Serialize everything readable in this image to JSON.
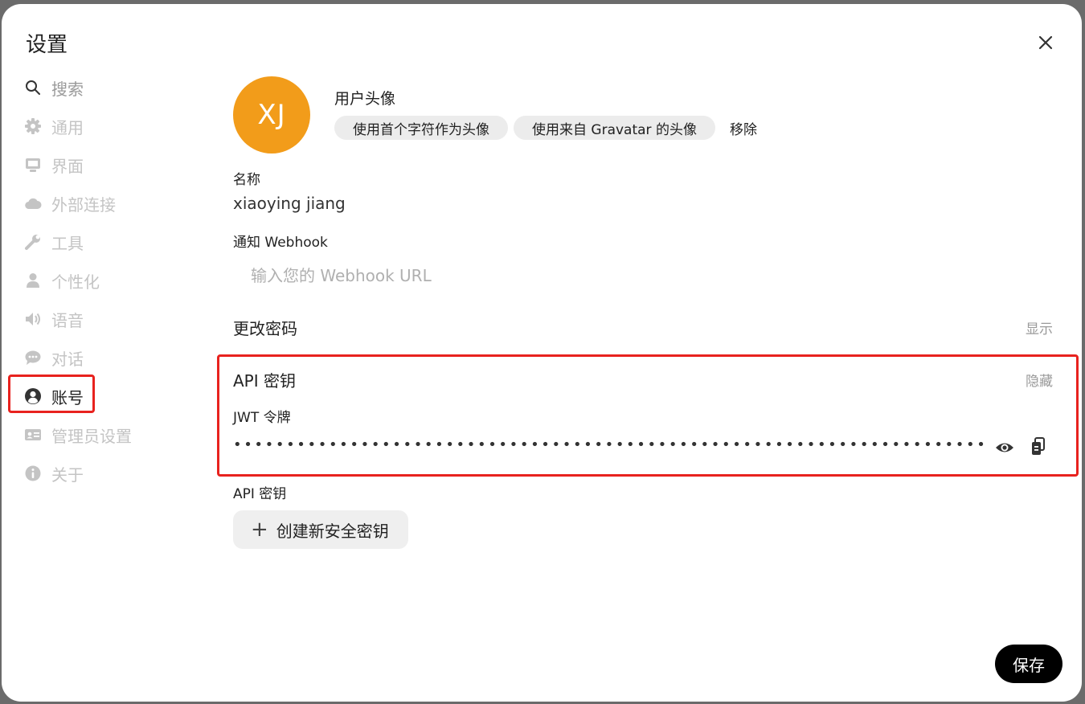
{
  "dialog": {
    "title": "设置",
    "close_icon": "close-icon"
  },
  "sidebar": {
    "items": [
      {
        "label": "搜索",
        "icon": "search-icon"
      },
      {
        "label": "通用",
        "icon": "gear-icon"
      },
      {
        "label": "界面",
        "icon": "monitor-icon"
      },
      {
        "label": "外部连接",
        "icon": "cloud-icon"
      },
      {
        "label": "工具",
        "icon": "wrench-icon"
      },
      {
        "label": "个性化",
        "icon": "person-icon"
      },
      {
        "label": "语音",
        "icon": "speaker-icon"
      },
      {
        "label": "对话",
        "icon": "chat-bubble-icon"
      },
      {
        "label": "账号",
        "icon": "user-circle-icon"
      },
      {
        "label": "管理员设置",
        "icon": "id-card-icon"
      },
      {
        "label": "关于",
        "icon": "info-icon"
      }
    ],
    "active": "账号"
  },
  "account": {
    "avatar": {
      "initials": "XJ",
      "color": "#f29c1a",
      "title": "用户头像"
    },
    "avatar_actions": {
      "use_initials": "使用首个字符作为头像",
      "use_gravatar": "使用来自 Gravatar 的头像",
      "remove": "移除"
    },
    "name": {
      "label": "名称",
      "value": "xiaoying jiang"
    },
    "webhook": {
      "label": "通知 Webhook",
      "placeholder": "输入您的 Webhook URL"
    },
    "change_password": {
      "title": "更改密码",
      "toggle": "显示"
    },
    "api_keys": {
      "title": "API 密钥",
      "toggle": "隐藏",
      "jwt_label": "JWT 令牌",
      "jwt_masked": "••••••••••••••••••••••••••••••••••••••••••••••••••••••••••••••••••••••••••••••••••••••••••••",
      "api_key_label": "API 密钥",
      "create_button": "创建新安全密钥"
    },
    "save_button": "保存"
  },
  "colors": {
    "highlight": "#e8221e",
    "avatar": "#f29c1a",
    "save_bg": "#000000"
  }
}
